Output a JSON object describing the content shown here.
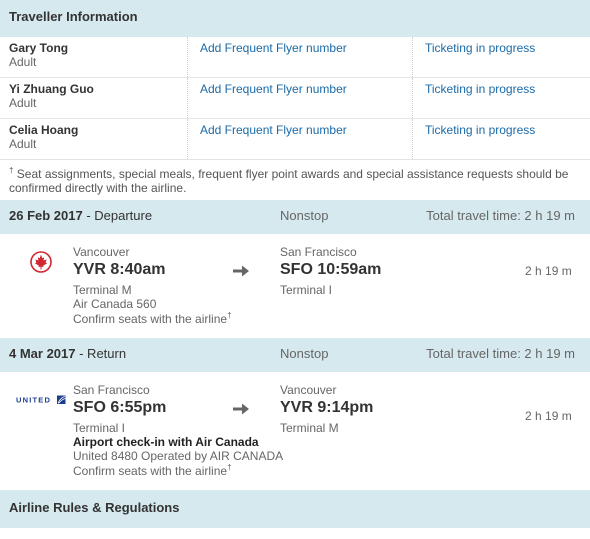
{
  "traveller_section": {
    "title": "Traveller Information",
    "travellers": [
      {
        "name": "Gary Tong",
        "type": "Adult",
        "ffn_link": "Add Frequent Flyer number",
        "status": "Ticketing in progress"
      },
      {
        "name": "Yi Zhuang Guo",
        "type": "Adult",
        "ffn_link": "Add Frequent Flyer number",
        "status": "Ticketing in progress"
      },
      {
        "name": "Celia Hoang",
        "type": "Adult",
        "ffn_link": "Add Frequent Flyer number",
        "status": "Ticketing in progress"
      }
    ],
    "footnote_mark": "†",
    "footnote": "Seat assignments, special meals, frequent flyer point awards and special assistance requests should be confirmed directly with the airline."
  },
  "departure": {
    "date": "26 Feb 2017",
    "direction": " - Departure",
    "stops": "Nonstop",
    "total_time": "Total travel time: 2 h 19 m",
    "airline_logo": "air-canada-maple-leaf-logo",
    "from_city": "Vancouver",
    "from_time": "YVR 8:40am",
    "from_terminal": "Terminal M",
    "flight": "Air Canada 560",
    "seats": "Confirm seats with the airline",
    "seats_mark": "†",
    "to_city": "San Francisco",
    "to_time": "SFO 10:59am",
    "to_terminal": "Terminal I",
    "duration": "2 h 19 m"
  },
  "return": {
    "date": "4 Mar 2017",
    "direction": " - Return",
    "stops": "Nonstop",
    "total_time": "Total travel time: 2 h 19 m",
    "airline_logo": "united-airlines-logo",
    "airline_logo_text": "UNITED",
    "from_city": "San Francisco",
    "from_time": "SFO 6:55pm",
    "from_terminal": "Terminal I",
    "checkin": "Airport check-in with Air Canada",
    "flight": "United 8480 Operated by AIR CANADA",
    "seats": "Confirm seats with the airline",
    "seats_mark": "†",
    "to_city": "Vancouver",
    "to_time": "YVR 9:14pm",
    "to_terminal": "Terminal M",
    "duration": "2 h 19 m"
  },
  "rules_section": {
    "title": "Airline Rules & Regulations"
  },
  "colors": {
    "header_bg": "#d5e9ee",
    "link": "#1a6aa8",
    "air_canada_red": "#d22630",
    "united_blue": "#1b3d8f"
  }
}
